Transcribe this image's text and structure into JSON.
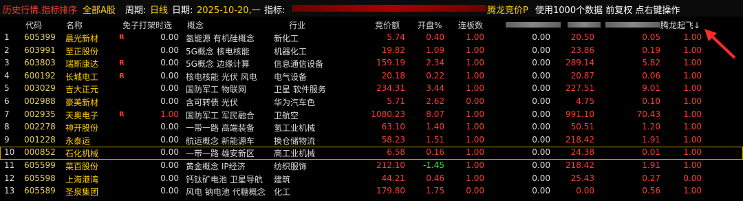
{
  "title_bar": {
    "history": "历史行情.指标排序",
    "scope": "全部A股",
    "period_label": "周期:",
    "period_value": "日线",
    "date_label": "日期:",
    "date_value": "2025-10-20,一",
    "indicator_label": "指标:",
    "indicator_value": "腾龙竞价P",
    "hint": "使用1000个数据 前复权 点右键操作"
  },
  "columns": {
    "code": "代码",
    "name": "名称",
    "f1": "免子打架时选",
    "concept": "概念",
    "industry": "行业",
    "price": "竞价额",
    "open": "开盘%",
    "lianban": "连板数",
    "tenglong": "腾龙起飞↓"
  },
  "rows": [
    {
      "i": "1",
      "code": "605399",
      "name": "晨光新材",
      "r": "R",
      "f1": "0.00",
      "concept": "氢能源 有机硅概念",
      "industry": "新化工",
      "price": "5.74",
      "open": "0.40",
      "lb": "1.00",
      "v1": "0.00",
      "v2": "20.50",
      "v3": "0.05",
      "v4": "1.00"
    },
    {
      "i": "2",
      "code": "603991",
      "name": "至正股份",
      "r": "",
      "f1": "0.00",
      "concept": "5G概念 核电核能",
      "industry": "机器化工",
      "price": "19.82",
      "open": "1.09",
      "lb": "1.00",
      "v1": "0.00",
      "v2": "23.86",
      "v3": "0.19",
      "v4": "1.00"
    },
    {
      "i": "3",
      "code": "603803",
      "name": "瑞斯康达",
      "r": "R",
      "f1": "0.00",
      "concept": "5G概念 边缘计算",
      "industry": "信息通信设备",
      "price": "159.19",
      "open": "2.34",
      "lb": "1.00",
      "v1": "0.00",
      "v2": "289.14",
      "v3": "5.82",
      "v4": "1.00"
    },
    {
      "i": "4",
      "code": "600192",
      "name": "长城电工",
      "r": "R",
      "f1": "0.00",
      "concept": "核电核能 光伏 风电",
      "industry": "电气设备",
      "price": "20.18",
      "open": "0.22",
      "lb": "1.00",
      "v1": "0.00",
      "v2": "20.87",
      "v3": "0.06",
      "v4": "1.00"
    },
    {
      "i": "5",
      "code": "003029",
      "name": "吉大正元",
      "r": "",
      "f1": "0.00",
      "concept": "国防军工 物联网",
      "industry": "卫星 软件服务",
      "price": "234.31",
      "open": "3.44",
      "lb": "1.00",
      "v1": "0.00",
      "v2": "227.51",
      "v3": "9.01",
      "v4": "1.00"
    },
    {
      "i": "6",
      "code": "002988",
      "name": "豪美新材",
      "r": "",
      "f1": "0.00",
      "concept": "含可转债 光伏",
      "industry": "华为汽车色",
      "price": "5.71",
      "open": "2.62",
      "lb": "0.00",
      "v1": "0.00",
      "v2": "4.75",
      "v3": "0.10",
      "v4": "1.00"
    },
    {
      "i": "7",
      "code": "002935",
      "name": "天奥电子",
      "r": "R",
      "f1": "1.00",
      "f1red": true,
      "concept": "国防军工 军民融合",
      "industry": "卫航空",
      "price": "1080.23",
      "open": "8.07",
      "lb": "1.00",
      "v1": "0.00",
      "v2": "991.10",
      "v3": "70.43",
      "v4": "1.00"
    },
    {
      "i": "8",
      "code": "002278",
      "name": "神开股份",
      "r": "",
      "f1": "0.00",
      "concept": "一带一路 高端装备",
      "industry": "氢工业机械",
      "price": "63.10",
      "open": "1.40",
      "lb": "1.00",
      "v1": "0.00",
      "v2": "50.51",
      "v3": "1.20",
      "v4": "1.00"
    },
    {
      "i": "9",
      "code": "001228",
      "name": "永泰运",
      "r": "",
      "f1": "0.00",
      "concept": "航运概念 新能源车",
      "industry": "换仓储物流",
      "price": "58.23",
      "open": "1.51",
      "lb": "1.00",
      "v1": "0.00",
      "v2": "218.42",
      "v3": "1.91",
      "v4": "1.00"
    },
    {
      "i": "10",
      "code": "000852",
      "name": "石化机械",
      "r": "",
      "f1": "0.00",
      "concept": "一带一路 雄安新区",
      "industry": "高工业机械",
      "price": "6.58",
      "open": "0.16",
      "lb": "1.00",
      "v1": "0.00",
      "v2": "24.38",
      "v3": "0.01",
      "v4": "1.00",
      "sel": true
    },
    {
      "i": "11",
      "code": "605599",
      "name": "菜百股份",
      "r": "",
      "f1": "0.00",
      "concept": "黄金概念 IP经济",
      "industry": "纺织服饰",
      "price": "212.10",
      "open": "-1.45",
      "openGreen": true,
      "lb": "1.00",
      "v1": "0.00",
      "v2": "218.42",
      "v3": "1.91",
      "v4": "1.00"
    },
    {
      "i": "12",
      "code": "605598",
      "name": "上海港湾",
      "r": "",
      "f1": "0.00",
      "concept": "钙钛矿电池 卫星导航",
      "industry": "建筑",
      "price": "44.21",
      "open": "0.46",
      "lb": "1.00",
      "v1": "0.00",
      "v2": "25.43",
      "v3": "0.27",
      "v4": "0.00"
    },
    {
      "i": "13",
      "code": "605589",
      "name": "圣泉集团",
      "r": "",
      "f1": "0.00",
      "concept": "风电 钠电池 代糖概念",
      "industry": "化工",
      "price": "179.80",
      "open": "1.75",
      "lb": "0.00",
      "v1": "0.00",
      "v2": "0.00",
      "v3": "0.56",
      "v4": "1.00"
    }
  ]
}
